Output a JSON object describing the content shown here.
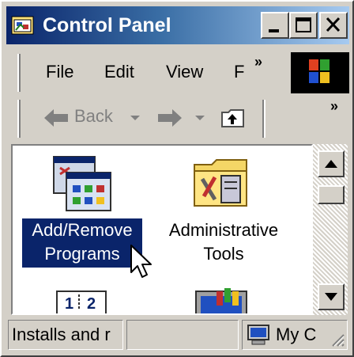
{
  "window": {
    "title": "Control Panel"
  },
  "menu": {
    "items": [
      "File",
      "Edit",
      "View",
      "F"
    ],
    "more": "»"
  },
  "toolbar": {
    "back_label": "Back",
    "more": "»"
  },
  "items": [
    {
      "label": "Add/Remove Programs",
      "lines": [
        "Add/Remove",
        "Programs"
      ],
      "icon": "add-remove-programs-icon",
      "selected": true
    },
    {
      "label": "Administrative Tools",
      "lines": [
        "Administrative",
        "Tools"
      ],
      "icon": "administrative-tools-icon",
      "selected": false
    },
    {
      "label": "",
      "icon": "date-time-icon"
    },
    {
      "label": "",
      "icon": "display-icon"
    }
  ],
  "status": {
    "description": "Installs and r",
    "location": "My C"
  },
  "colors": {
    "title_start": "#0a246a",
    "title_end": "#a6caf0",
    "selection": "#0a246a",
    "face": "#d4d0c8"
  }
}
